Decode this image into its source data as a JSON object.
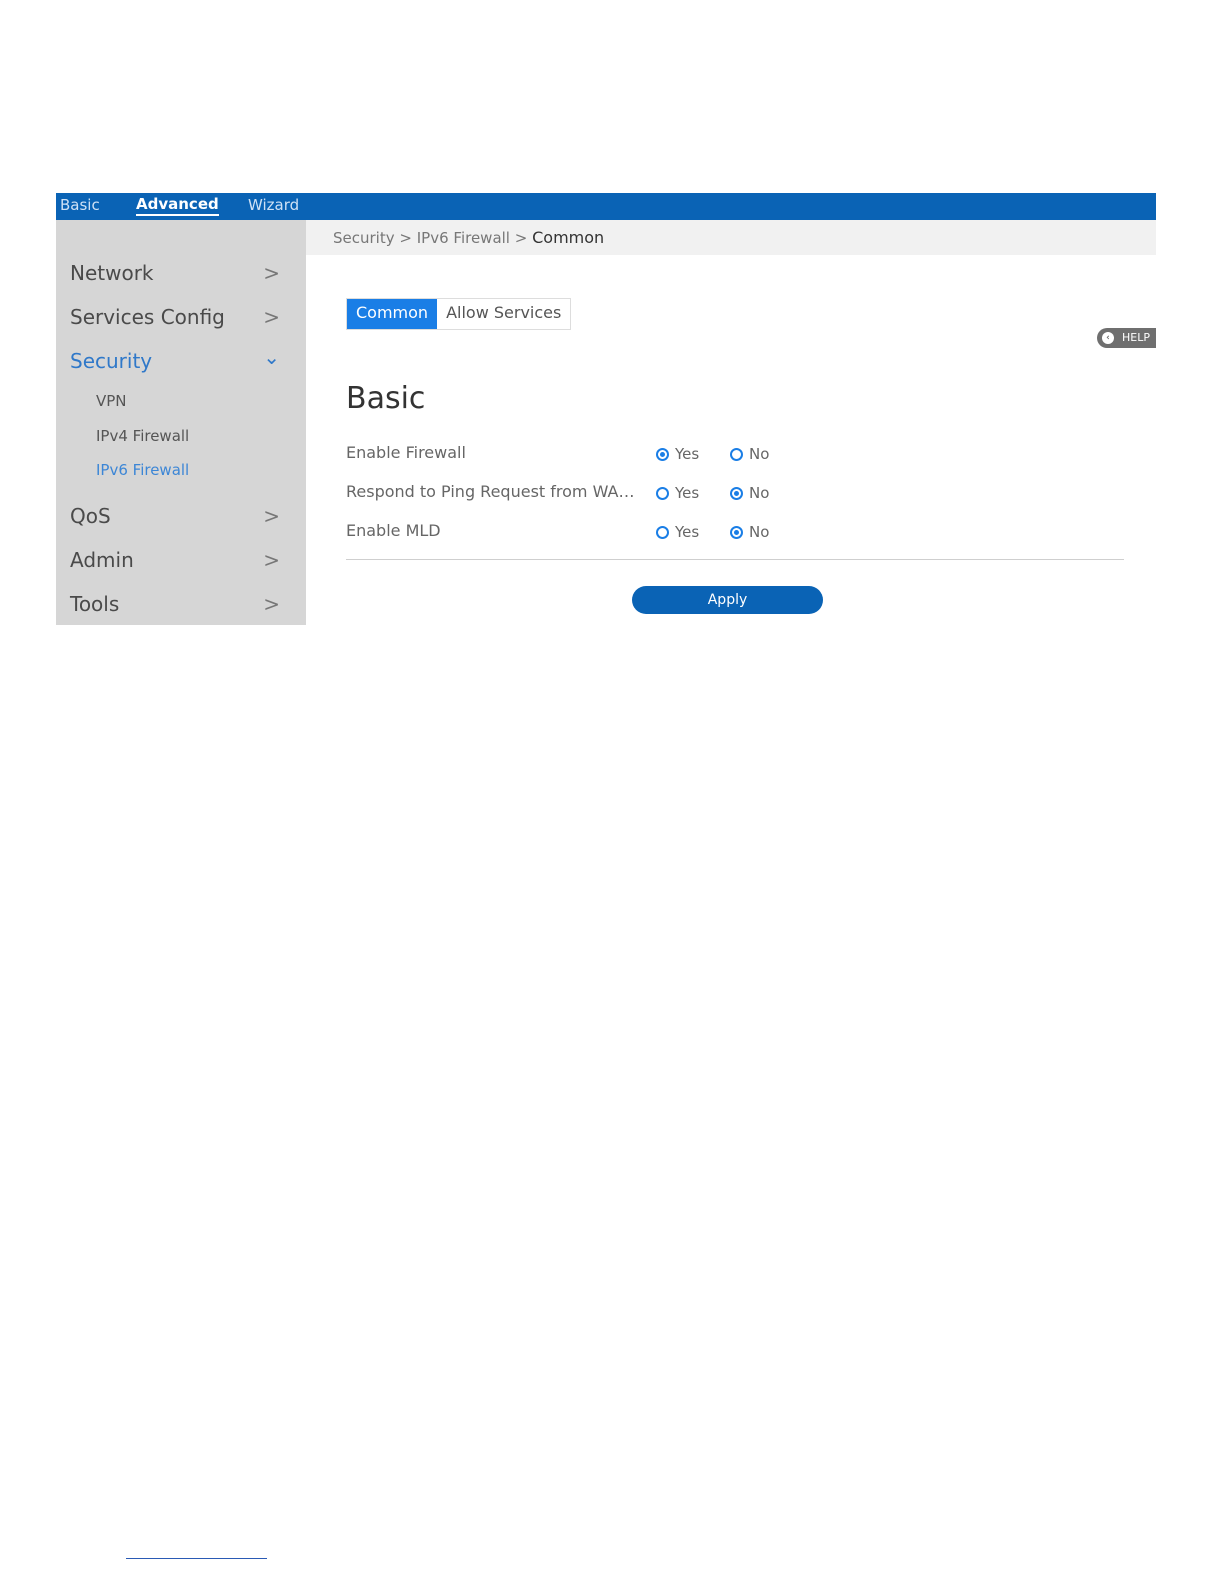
{
  "topnav": {
    "items": [
      {
        "label": "Basic"
      },
      {
        "label": "Advanced"
      },
      {
        "label": "Wizard"
      }
    ],
    "active": "Advanced"
  },
  "sidebar": {
    "items": [
      {
        "label": "Network",
        "chevron": ">"
      },
      {
        "label": "Services Config",
        "chevron": ">"
      },
      {
        "label": "Security",
        "chevron": "⌄"
      },
      {
        "label": "QoS",
        "chevron": ">"
      },
      {
        "label": "Admin",
        "chevron": ">"
      },
      {
        "label": "Tools",
        "chevron": ">"
      }
    ],
    "security_sub": [
      {
        "label": "VPN"
      },
      {
        "label": "IPv4 Firewall"
      },
      {
        "label": "IPv6 Firewall"
      }
    ]
  },
  "breadcrumb": {
    "part1": "Security",
    "sep": ">",
    "part2": "IPv6 Firewall",
    "current": "Common"
  },
  "tabs": [
    {
      "label": "Common"
    },
    {
      "label": "Allow Services"
    }
  ],
  "help": {
    "label": "HELP",
    "icon": "‹"
  },
  "section": {
    "title": "Basic"
  },
  "rows": [
    {
      "label": "Enable Firewall",
      "yes": "Yes",
      "no": "No",
      "selected": "Yes"
    },
    {
      "label": "Respond to Ping Request from WA…",
      "yes": "Yes",
      "no": "No",
      "selected": "No"
    },
    {
      "label": "Enable MLD",
      "yes": "Yes",
      "no": "No",
      "selected": "No"
    }
  ],
  "apply": {
    "label": "Apply"
  },
  "colors": {
    "primary": "#0a63b5",
    "tab_active": "#1a7ee6",
    "sidebar_bg": "#d6d6d6",
    "active_nav": "#2f78c9"
  }
}
